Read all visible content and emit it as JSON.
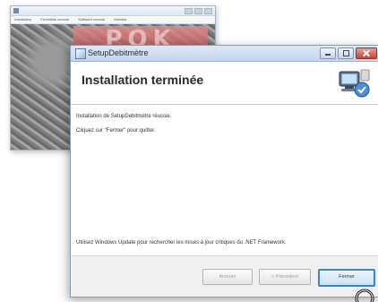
{
  "background_window": {
    "menu": [
      "Installation",
      "Flexibilitat manual",
      "Software manual",
      "Website"
    ],
    "logo_text": "POK"
  },
  "dialog": {
    "title": "SetupDebitmètre",
    "header_title": "Installation terminée",
    "messages": [
      "Installation de SetupDebitmètre réussie.",
      "Cliquez sur \"Fermer\" pour quitter.",
      "Utilisez Windows Update pour rechercher les mises à jour critiques du .NET Framework."
    ],
    "buttons": {
      "cancel": "Annuler",
      "previous": "< Précédent",
      "close": "Fermer"
    }
  },
  "colors": {
    "accent": "#3b86c9",
    "close_button": "#c6452e",
    "titlebar": "#c4d5ea"
  },
  "icons": {
    "app": "installer-icon",
    "header": "computer-setup-icon",
    "cursor": "mouse-pointer-icon"
  }
}
